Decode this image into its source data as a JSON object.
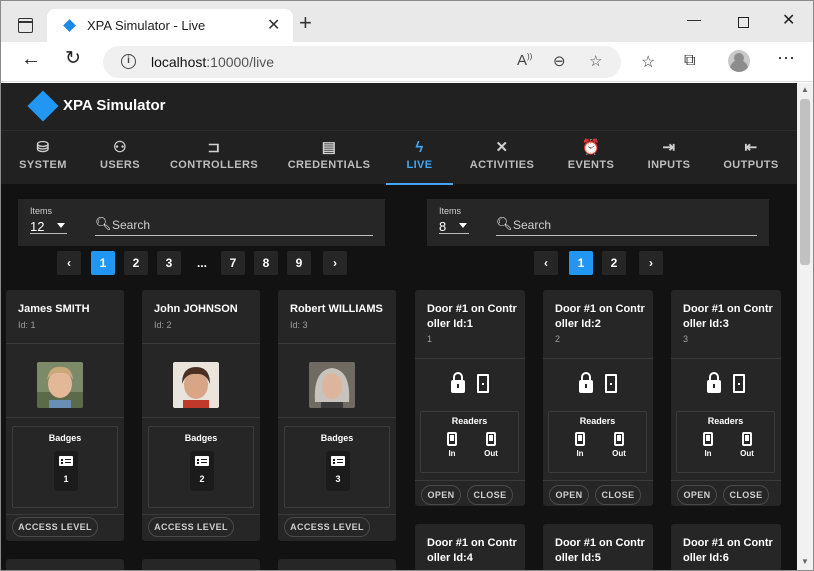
{
  "browser": {
    "tab_title": "XPA Simulator - Live",
    "url_host": "localhost",
    "url_rest": ":10000/live"
  },
  "app": {
    "title": "XPA Simulator",
    "accent_color": "#2196f3",
    "nav": [
      {
        "label": "SYSTEM",
        "icon": "database-icon"
      },
      {
        "label": "USERS",
        "icon": "users-icon"
      },
      {
        "label": "CONTROLLERS",
        "icon": "controller-icon"
      },
      {
        "label": "CREDENTIALS",
        "icon": "credential-card-icon"
      },
      {
        "label": "LIVE",
        "icon": "bolt-icon",
        "active": true
      },
      {
        "label": "ACTIVITIES",
        "icon": "tools-icon"
      },
      {
        "label": "EVENTS",
        "icon": "alarm-icon"
      },
      {
        "label": "INPUTS",
        "icon": "input-icon"
      },
      {
        "label": "OUTPUTS",
        "icon": "output-icon"
      }
    ]
  },
  "users_panel": {
    "items_label": "Items",
    "items_value": "12",
    "search_placeholder": "Search",
    "pages": [
      "1",
      "2",
      "3",
      "...",
      "7",
      "8",
      "9"
    ],
    "active_page": "1",
    "badges_label": "Badges",
    "access_level_label": "ACCESS LEVEL",
    "users": [
      {
        "name": "James SMITH",
        "id": "Id: 1",
        "badge": "1"
      },
      {
        "name": "John JOHNSON",
        "id": "Id: 2",
        "badge": "2"
      },
      {
        "name": "Robert WILLIAMS",
        "id": "Id: 3",
        "badge": "3"
      }
    ]
  },
  "doors_panel": {
    "items_label": "Items",
    "items_value": "8",
    "search_placeholder": "Search",
    "pages": [
      "1",
      "2"
    ],
    "active_page": "1",
    "readers_label": "Readers",
    "reader_in": "In",
    "reader_out": "Out",
    "open_label": "OPEN",
    "close_label": "CLOSE",
    "doors": [
      {
        "name_l1": "Door #1 on Contr",
        "name_l2": "oller Id:1",
        "id": "1"
      },
      {
        "name_l1": "Door #1 on Contr",
        "name_l2": "oller Id:2",
        "id": "2"
      },
      {
        "name_l1": "Door #1 on Contr",
        "name_l2": "oller Id:3",
        "id": "3"
      },
      {
        "name_l1": "Door #1 on Contr",
        "name_l2": "oller Id:4"
      },
      {
        "name_l1": "Door #1 on Contr",
        "name_l2": "oller Id:5"
      },
      {
        "name_l1": "Door #1 on Contr",
        "name_l2": "oller Id:6"
      }
    ]
  }
}
